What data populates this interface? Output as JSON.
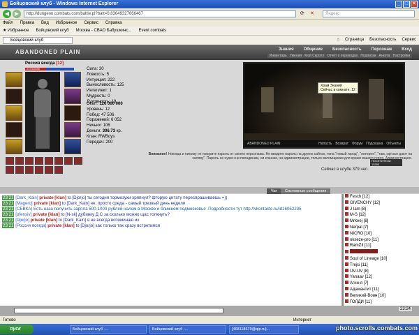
{
  "window": {
    "title": "Бойцовский клуб - Windows Internet Explorer"
  },
  "browser": {
    "url": "http://dungeon.combats.com/battle.pl?batt=0.83649327666467",
    "search_placeholder": "Яндекс",
    "menu": [
      "Файл",
      "Правка",
      "Вид",
      "Избранное",
      "Сервис",
      "Справка"
    ],
    "favorites": [
      "Избранное",
      "Бойцовский клуб",
      "Москва - СВАО Бабушкинс...",
      "Event combats"
    ],
    "tab": "Бойцовский клуб",
    "tools": [
      "Страница",
      "Безопасность",
      "Сервис"
    ]
  },
  "game": {
    "logo": "ABANDONED PLAIN",
    "nav_top": [
      "Знания",
      "Общение",
      "Безопасность",
      "Персонаж",
      "Вход"
    ],
    "nav_bottom": [
      "Инвентарь",
      "Умения",
      "Мой Скролл",
      "Отчёт о переводах",
      "Подписки",
      "Анкета",
      "Настройки"
    ],
    "character": {
      "name": "Россия всегда",
      "level": "[12]",
      "hp": "2373/2656",
      "stats": [
        "Сила: 30",
        "Ловкость: 5",
        "Интуиция: 222",
        "Выносливость: 125",
        "Интеллект: 1",
        "Мудрость: 0",
        "Духовность: 19"
      ],
      "exp_label": "Опыт:",
      "exp_value": "120 000 000",
      "info": [
        "Уровень: 12",
        "Побед: 47 506",
        "Поражений: 6 052",
        "Ничьих: 106"
      ],
      "money_label": "Деньги:",
      "money_value": "306.73",
      "money_unit": "кр.",
      "clan": "Клан: RWBoys",
      "transfers": "Передач: 200"
    },
    "scene": {
      "tooltip_title": "Храм Знаний",
      "tooltip_text": "Сейчас в комнате: 12",
      "location": "ABANDONED PLAIN",
      "links": [
        "Напасть",
        "Возврат",
        "Форум",
        "Подсказка",
        "Объекты"
      ]
    },
    "warning_bold": "Внимание!",
    "warning_text": "Никогда и никому не говорите пароль от своего персонажа. Не вводите пароль на других сайтах, типа \"новый город\", \"лотерея\", \"там, где все дают на халяву\". Пароль не нужен ни паладинам, ни кланам, ни администрации, только взломщикам для кражи вашего героя.",
    "admin": "Администрация.",
    "online": "Сейчас в клубе 379 чел.",
    "counter_label": "ПОСЕТИТЕЛИ",
    "counter_value": "15390"
  },
  "chat_tabs": [
    "Чат",
    "Системные сообщения"
  ],
  "chat": [
    {
      "time": "23:21",
      "nick": "[Dark_Kain]",
      "priv": "private [klan]",
      "msg": "to [Djorjo] ты сегодня тормозухи хряпнул? фторую цитату переспрашиваешь =))"
    },
    {
      "time": "23:21",
      "nick": "[Magero]",
      "priv": "private [klan]",
      "msg": "to [Dark_Kain] не, просто среда - самый трезвый день недели"
    },
    {
      "time": "23:21",
      "nick": "[СЕВКА]",
      "priv": "",
      "msg": "Есть наза получить зарпла 500-1000 рублей налом в Москве и ближнем подмосковье .Подробности тут http://vkontakte.ru/id16052235"
    },
    {
      "time": "23:21",
      "nick": "[ofensiv]",
      "priv": "private [klan]",
      "msg": "to [N-sk] дубинку Д С за сколько можно щас толкнуть?"
    },
    {
      "time": "23:21",
      "nick": "[Djorjo]",
      "priv": "private [klan]",
      "msg": "to [Dark_Kain] я не всегда вспоминаю их"
    },
    {
      "time": "23:21",
      "nick": "[Россия всегда]",
      "priv": "private [klan]",
      "msg": "to [Djorjo] как только так сразу встретимся"
    }
  ],
  "users": [
    "Fesch [12]",
    "GIVENCHY [12]",
    "J Iam [8]",
    "M-S [12]",
    "Mrkeej [8]",
    "Nerpal [7]",
    "NICRO [10]",
    "okseze-pro [11]",
    "RamZIl [11]",
    "",
    "Soul of Lineage [10]",
    "Trejci [11]",
    "UV-UV [8]",
    "Yanaav [12]",
    "Агни-я [7]",
    "Адамантит [11]",
    "Великий-Воин [10]",
    "ГОЛДИ [11]"
  ],
  "clock": "23:24",
  "status": {
    "left": "Готово",
    "zone": "Интернет"
  },
  "taskbar": {
    "start": "пуск",
    "tasks": [
      "Бойцовский клуб -...",
      "Бойцовский клуб -...",
      "[468118670@qip.ru]..."
    ]
  },
  "watermark": "photo.scrolls.combats.com"
}
